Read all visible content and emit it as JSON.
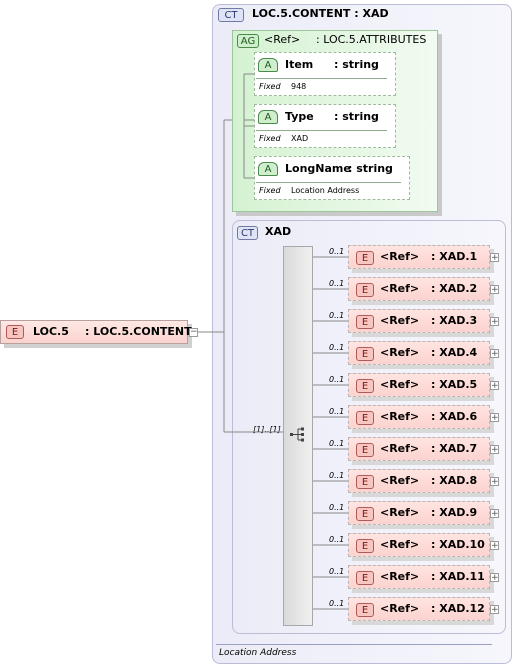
{
  "root_element": {
    "badge": "E",
    "name": "LOC.5",
    "type": ": LOC.5.CONTENT"
  },
  "complex_type": {
    "badge": "CT",
    "title": "LOC.5.CONTENT : XAD",
    "annotation": "Location Address"
  },
  "attribute_group": {
    "badge": "AG",
    "ref": "<Ref>",
    "type": ": LOC.5.ATTRIBUTES",
    "attributes": [
      {
        "badge": "A",
        "name": "Item",
        "type": ": string",
        "fixed_label": "Fixed",
        "fixed_value": "948"
      },
      {
        "badge": "A",
        "name": "Type",
        "type": ": string",
        "fixed_label": "Fixed",
        "fixed_value": "XAD"
      },
      {
        "badge": "A",
        "name": "LongName",
        "type": ": string",
        "fixed_label": "Fixed",
        "fixed_value": "Location Address"
      }
    ]
  },
  "inner_type": {
    "badge": "CT",
    "name": "XAD",
    "multiplicity": "[1]..[1]"
  },
  "elements": [
    {
      "badge": "E",
      "ref": "<Ref>",
      "type": ": XAD.1",
      "occurs": "0..1"
    },
    {
      "badge": "E",
      "ref": "<Ref>",
      "type": ": XAD.2",
      "occurs": "0..1"
    },
    {
      "badge": "E",
      "ref": "<Ref>",
      "type": ": XAD.3",
      "occurs": "0..1"
    },
    {
      "badge": "E",
      "ref": "<Ref>",
      "type": ": XAD.4",
      "occurs": "0..1"
    },
    {
      "badge": "E",
      "ref": "<Ref>",
      "type": ": XAD.5",
      "occurs": "0..1"
    },
    {
      "badge": "E",
      "ref": "<Ref>",
      "type": ": XAD.6",
      "occurs": "0..1"
    },
    {
      "badge": "E",
      "ref": "<Ref>",
      "type": ": XAD.7",
      "occurs": "0..1"
    },
    {
      "badge": "E",
      "ref": "<Ref>",
      "type": ": XAD.8",
      "occurs": "0..1"
    },
    {
      "badge": "E",
      "ref": "<Ref>",
      "type": ": XAD.9",
      "occurs": "0..1"
    },
    {
      "badge": "E",
      "ref": "<Ref>",
      "type": ": XAD.10",
      "occurs": "0..1"
    },
    {
      "badge": "E",
      "ref": "<Ref>",
      "type": ": XAD.11",
      "occurs": "0..1"
    },
    {
      "badge": "E",
      "ref": "<Ref>",
      "type": ": XAD.12",
      "occurs": "0..1"
    }
  ],
  "expand_symbol": "+",
  "colors": {
    "element_fill": "#fbd3cf",
    "ct_fill": "#e9ebf8",
    "ag_fill": "#dcf5da",
    "border": "#a0a0a0"
  }
}
